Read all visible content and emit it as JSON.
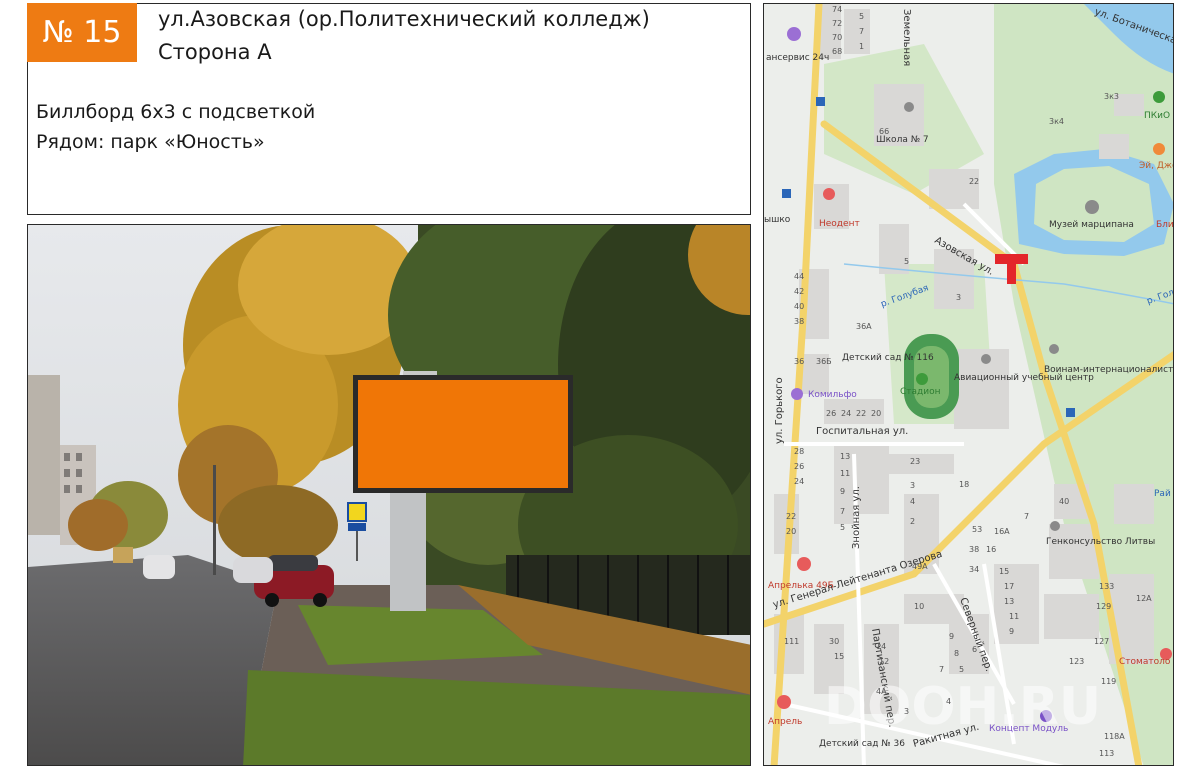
{
  "header": {
    "badge": "№ 15",
    "address": "ул.Азовская (ор.Политехнический колледж)",
    "side": "Сторона А"
  },
  "description": {
    "line1": "Биллборд 6х3 с подсветкой",
    "line2": "Рядом: парк «Юность»"
  },
  "colors": {
    "accent": "#ee7b13",
    "billboard": "#f07606",
    "marker": "#e3262a"
  },
  "map": {
    "streets": {
      "azovskaya": "Азовская ул.",
      "gorkogo": "ул. Горького",
      "ozerova": "ул. Генерал-Лейтенанта Озерова",
      "gospitalnaya": "Госпитальная ул.",
      "znoynaya": "Знойная ул.",
      "severny": "Северный пер.",
      "partizansky": "Партизанский пер.",
      "rakitnaya": "Ракитная ул.",
      "botanicheskaya": "ул. Ботаническая",
      "zemelnaya": "Земельная"
    },
    "rivers": {
      "r1": "р. Голубая",
      "r2": "р. Голу"
    },
    "places": {
      "museum": "Музей марципана",
      "stadium": "Стадион",
      "aviation": "Авиационный учебный центр",
      "school": "Школа № 7",
      "kindergarten116": "Детский сад № 116",
      "kindergarten36": "Детский сад № 36",
      "neodent": "Неодент",
      "komilfo": "Комильфо",
      "voinam": "Воинам-интернационалистам",
      "consulate": "Генконсульство Литвы",
      "aprelka1": "Апрелька 49Б",
      "aprelka2": "Апрель",
      "stomatolog": "Стоматоло",
      "pkio": "ПКиО Юн",
      "ei": "Эй, Джов",
      "blin": "Блин",
      "koncept": "Концепт Модуль",
      "servis": "ансервис 24ч",
      "ryshko": "ышко",
      "raj": "Рай"
    },
    "houses": [
      "74",
      "72",
      "70",
      "68",
      "5",
      "7",
      "1",
      "2",
      "66",
      "3к3",
      "3к4",
      "2",
      "5",
      "3",
      "44",
      "42",
      "40",
      "38",
      "36А",
      "36",
      "36Б",
      "26",
      "24",
      "22",
      "20",
      "28",
      "26",
      "24",
      "22",
      "20",
      "23",
      "18",
      "13",
      "11",
      "9",
      "7",
      "5",
      "3",
      "4",
      "2",
      "53",
      "49А",
      "38",
      "34",
      "16А",
      "16",
      "15",
      "17",
      "13",
      "11",
      "9",
      "7",
      "40",
      "133",
      "129",
      "127",
      "123",
      "12А",
      "119",
      "118А",
      "113",
      "111",
      "30",
      "15",
      "14",
      "12",
      "10",
      "9",
      "8",
      "7",
      "6",
      "5",
      "4А",
      "4",
      "3",
      "2",
      "1"
    ],
    "watermark": "DOOH.RU"
  }
}
